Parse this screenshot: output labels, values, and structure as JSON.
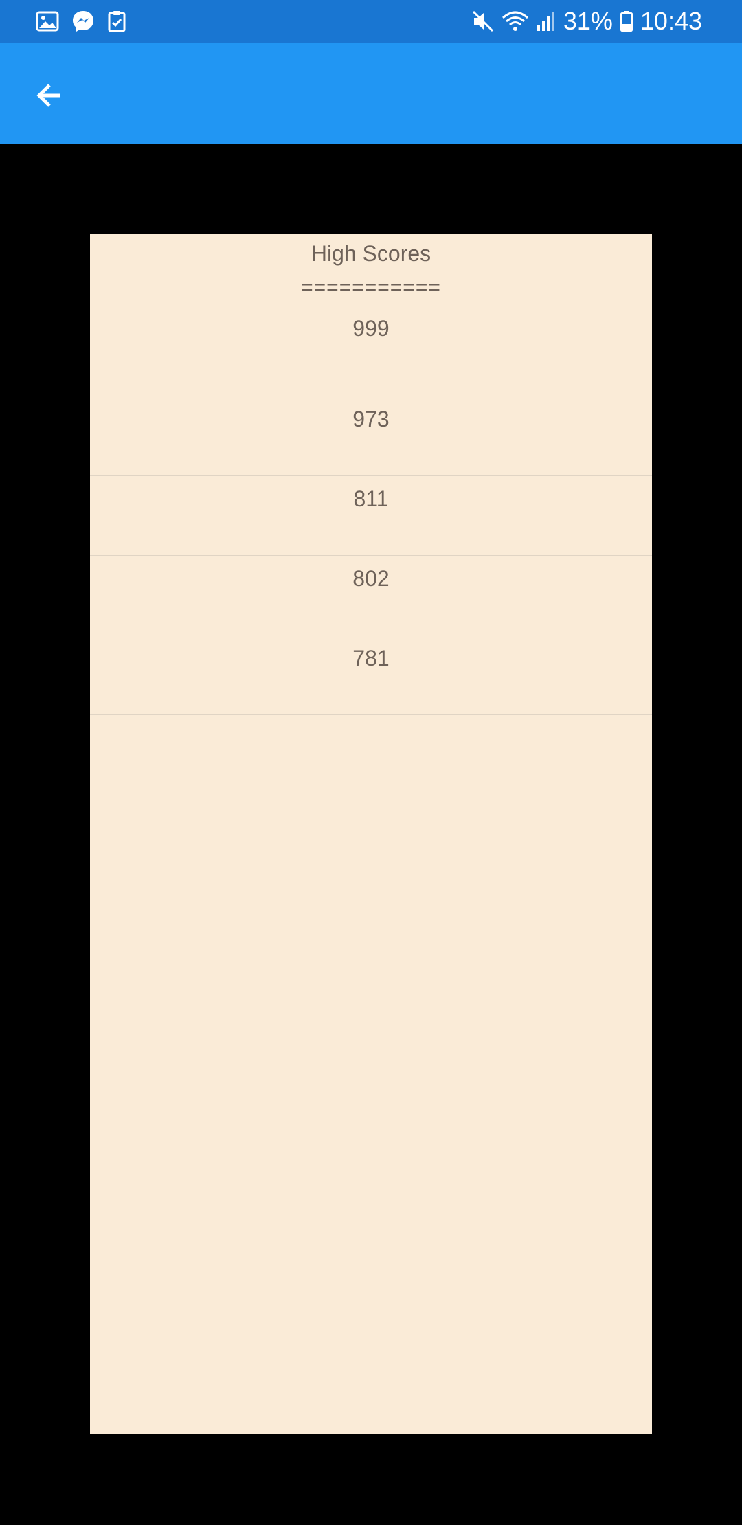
{
  "status_bar": {
    "left_icons": [
      "gallery-icon",
      "messenger-icon",
      "clipboard-check-icon"
    ],
    "right_icons": [
      "mute-icon",
      "wifi-icon",
      "signal-icon",
      "battery-icon"
    ],
    "battery_percent": "31%",
    "time": "10:43"
  },
  "app_bar": {
    "back_icon": "arrow-left-icon"
  },
  "panel": {
    "title": "High Scores",
    "separator": "===========",
    "scores": [
      "999",
      "973",
      "811",
      "802",
      "781"
    ]
  },
  "colors": {
    "status_bar": "#1976D2",
    "app_bar": "#2196F3",
    "background": "#000000",
    "panel": "#FAEBD7",
    "text": "#6E6259"
  }
}
